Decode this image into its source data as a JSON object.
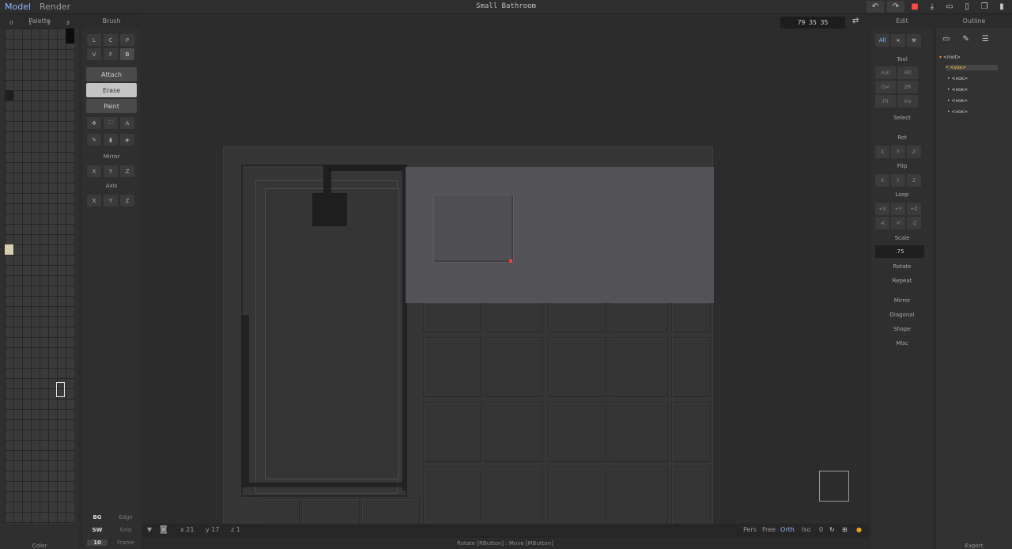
{
  "topbar": {
    "mode_model": "Model",
    "mode_render": "Render",
    "title": "Small Bathroom",
    "icons": [
      "undo-icon",
      "redo-icon",
      "save-icon",
      "import-icon",
      "open-folder-icon",
      "new-file-icon",
      "copy-icon",
      "delete-icon"
    ]
  },
  "palette": {
    "header": "Palette",
    "tabs": [
      "0",
      "1",
      "2",
      "3"
    ],
    "footer": "Color",
    "colors": {
      "black": "#0c0c0c",
      "dark": "#1f1f1f",
      "beige": "#d7cfad"
    }
  },
  "brush": {
    "header": "Brush",
    "row1": [
      "L",
      "C",
      "P"
    ],
    "row2": [
      "V",
      "F",
      "B"
    ],
    "attach": "Attach",
    "erase": "Erase",
    "paint": "Paint",
    "mirror_label": "Mirror",
    "mirror": [
      "X",
      "Y",
      "Z"
    ],
    "axis_label": "Axis",
    "axis": [
      "X",
      "Y",
      "Z"
    ],
    "bottom": [
      {
        "k": "BG",
        "v": "Edge"
      },
      {
        "k": "SW",
        "v": "Grid"
      },
      {
        "k": "10",
        "v": "Frame"
      }
    ]
  },
  "viewport": {
    "coords": "79  35  35",
    "bar": {
      "x": "x 21",
      "y": "y 17",
      "z": "z 1",
      "pers": "Pers",
      "free": "Free",
      "orth": "Orth",
      "iso": "Iso",
      "zero": "0"
    },
    "status": "Rotate [RButton] : Move [MButton]"
  },
  "edit": {
    "header": "Edit",
    "tabs": [
      "All"
    ],
    "tool_label": "Tool",
    "tool": [
      "Full",
      "Fill",
      "Ovl",
      "ZR",
      "Flt",
      "Inv"
    ],
    "select_label": "Select",
    "rot_label": "Rot",
    "rot": [
      "X",
      "Y",
      "Z"
    ],
    "flip_label": "Flip",
    "flip": [
      "X",
      "Y",
      "Z"
    ],
    "loop_label": "Loop",
    "loop": [
      "+X",
      "+Y",
      "+Z",
      "-X",
      "-Y",
      "-Z"
    ],
    "scale_label": "Scale",
    "scale_value": ".75",
    "rotate_label": "Rotate",
    "repeat_label": "Repeat",
    "mirror_label": "Mirror",
    "diagonal_label": "Diagonal",
    "shape_label": "Shape",
    "misc_label": "Misc"
  },
  "outline": {
    "header": "Outline",
    "root": "<root>",
    "items": [
      "<vox>",
      "<vox>",
      "<vox>",
      "<vox>",
      "<vox>"
    ],
    "footer": "Export"
  }
}
